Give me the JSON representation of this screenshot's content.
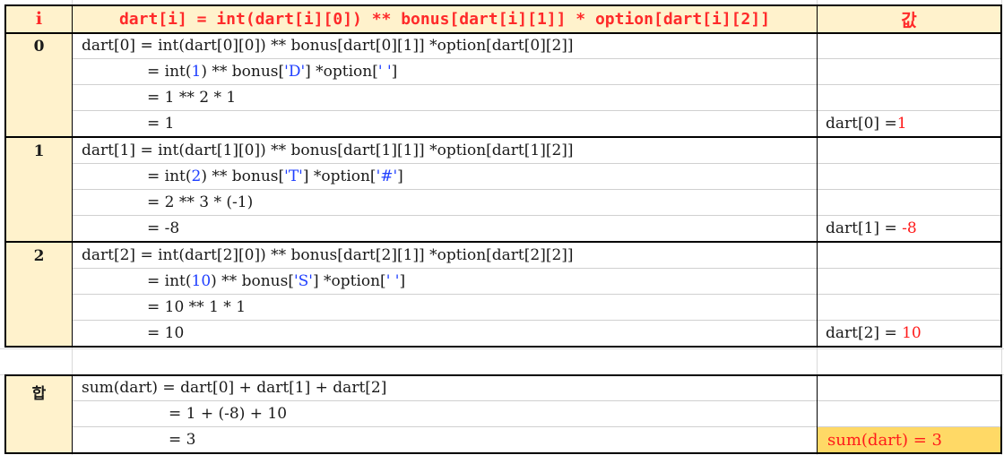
{
  "header": {
    "col_i": "i",
    "col_formula": "dart[i] = int(dart[i][0]) ** bonus[dart[i][1]] * option[dart[i][2]]",
    "col_value": "값"
  },
  "rows": [
    {
      "index": "0",
      "lines": [
        [
          "dart[0] = int(dart[0][0]) ** bonus[dart[0][1]] *option[dart[0][2]]"
        ],
        [
          "= int(",
          "1",
          ") ** bonus[",
          "'D'",
          "] *option[",
          "' '",
          "]"
        ],
        [
          "= 1 ** 2 * 1"
        ],
        [
          "= 1"
        ]
      ],
      "result_label": "dart[0] =",
      "result_value": "1"
    },
    {
      "index": "1",
      "lines": [
        [
          "dart[1] = int(dart[1][0]) ** bonus[dart[1][1]] *option[dart[1][2]]"
        ],
        [
          "= int(",
          "2",
          ") ** bonus[",
          "'T'",
          "] *option[",
          "'#'",
          "]"
        ],
        [
          "= 2 ** 3 * (-1)"
        ],
        [
          "= -8"
        ]
      ],
      "result_label": "dart[1] = ",
      "result_value": "-8"
    },
    {
      "index": "2",
      "lines": [
        [
          "dart[2] = int(dart[2][0]) ** bonus[dart[2][1]] *option[dart[2][2]]"
        ],
        [
          "= int(",
          "10",
          ") ** bonus[",
          "'S'",
          "] *option[",
          "' '",
          "]"
        ],
        [
          "= 10 ** 1 * 1"
        ],
        [
          "= 10"
        ]
      ],
      "result_label": "dart[2] = ",
      "result_value": "10"
    }
  ],
  "sum": {
    "label": "합",
    "line1": "sum(dart) = dart[0] + dart[1] + dart[2]",
    "line2": "= 1 + (-8) + 10",
    "line3": "= 3",
    "result": "sum(dart) = 3"
  },
  "colors": {
    "header_bg": "#fff2cc",
    "header_text": "#ff2a2a",
    "value_red": "#ff1a1a",
    "literal_blue": "#1f3fff",
    "sum_highlight": "#ffd966"
  }
}
